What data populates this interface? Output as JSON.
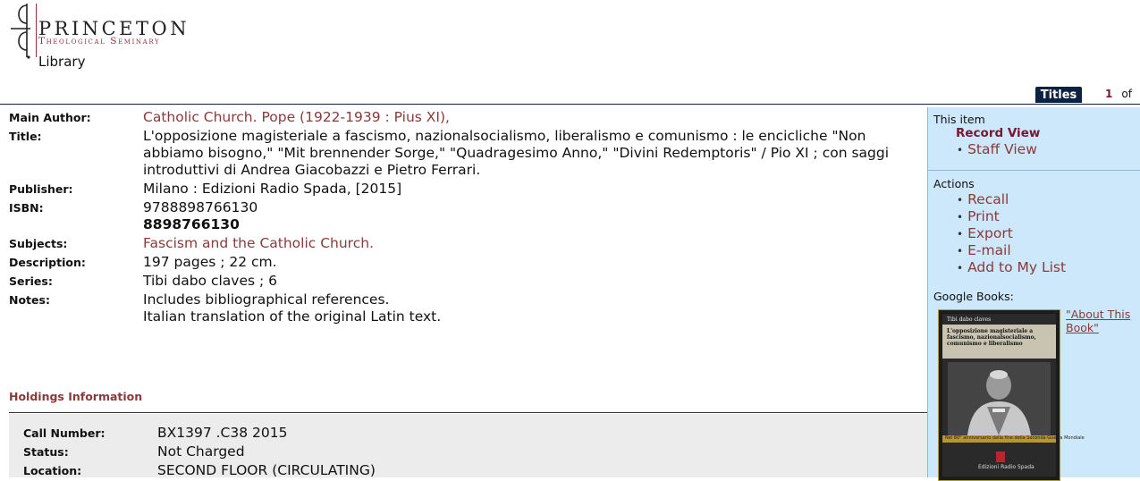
{
  "header": {
    "logo_name": "PRINCETON",
    "logo_sub": "Theological Seminary",
    "logo_library": "Library"
  },
  "tabs": {
    "titles_label": "Titles",
    "page_current": "1",
    "page_of": "of"
  },
  "record": {
    "main_author": {
      "label": "Main Author:",
      "value": "Catholic Church. Pope (1922-1939 : Pius XI),"
    },
    "title": {
      "label": "Title:",
      "value": "L'opposizione magisteriale a fascismo, nazionalsocialismo, liberalismo e comunismo : le encicliche \"Non abbiamo bisogno,\" \"Mit brennender Sorge,\" \"Quadragesimo Anno,\" \"Divini Redemptoris\" / Pio XI ; con saggi introduttivi di Andrea Giacobazzi e Pietro Ferrari."
    },
    "publisher": {
      "label": "Publisher:",
      "value": "Milano : Edizioni Radio Spada, [2015]"
    },
    "isbn": {
      "label": "ISBN:",
      "value1": "9788898766130",
      "value2": "8898766130"
    },
    "subjects": {
      "label": "Subjects:",
      "value": "Fascism and the Catholic Church."
    },
    "description": {
      "label": "Description:",
      "value": "197 pages ; 22 cm."
    },
    "series": {
      "label": "Series:",
      "value": "Tibi dabo claves ; 6"
    },
    "notes": {
      "label": "Notes:",
      "value1": "Includes bibliographical references.",
      "value2": "Italian translation of the original Latin text."
    }
  },
  "holdings": {
    "heading": "Holdings Information",
    "call_number": {
      "label": "Call Number:",
      "value": "BX1397 .C38 2015"
    },
    "status": {
      "label": "Status:",
      "value": "Not Charged"
    },
    "location": {
      "label": "Location:",
      "value": "SECOND FLOOR (CIRCULATING)"
    }
  },
  "sidebar": {
    "this_item_label": "This item",
    "record_view": "Record View",
    "staff_view": "Staff View",
    "actions_label": "Actions",
    "actions": [
      "Recall",
      "Print",
      "Export",
      "E-mail",
      "Add to My List"
    ],
    "google_books_label": "Google Books:",
    "about_link": "\"About This Book\"",
    "cover": {
      "series": "Tibi dabo claves",
      "title": "L'opposizione magisteriale a fascismo, nazionalsocialismo, comunismo e liberalismo",
      "gold_text": "Nel 80° anniversario della fine della Seconda Guerra Mondiale",
      "publisher": "Edizioni Radio Spada"
    }
  },
  "colors": {
    "link": "#8a3a3a",
    "navy": "#0d2240",
    "sidebar_bg": "#cde7fb",
    "brand": "#9c2b3c"
  }
}
